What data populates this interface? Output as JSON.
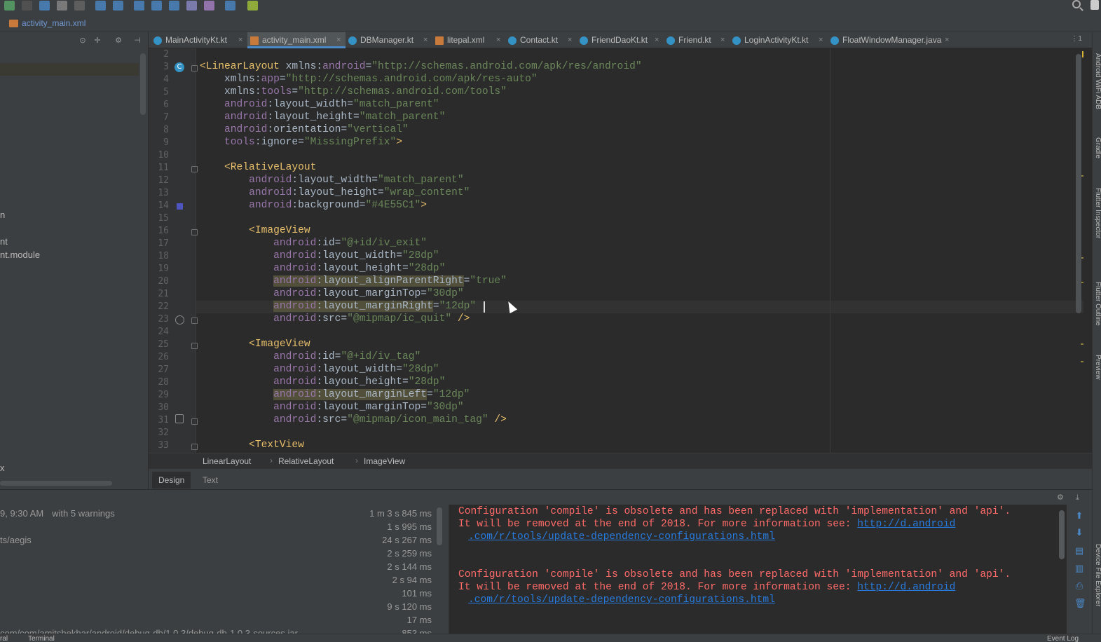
{
  "breadcrumb_file": "activity_main.xml",
  "project_panel": {
    "lines": [
      "n",
      "nt",
      "nt.module",
      "x"
    ]
  },
  "tabs": [
    {
      "label": "MainActivityKt.kt",
      "kind": "kotlin",
      "active": false
    },
    {
      "label": "activity_main.xml",
      "kind": "xml",
      "active": true
    },
    {
      "label": "DBManager.kt",
      "kind": "kotlin",
      "active": false
    },
    {
      "label": "litepal.xml",
      "kind": "xml",
      "active": false
    },
    {
      "label": "Contact.kt",
      "kind": "kotlin",
      "active": false
    },
    {
      "label": "FriendDaoKt.kt",
      "kind": "kotlin",
      "active": false
    },
    {
      "label": "Friend.kt",
      "kind": "kotlin",
      "active": false
    },
    {
      "label": "LoginActivityKt.kt",
      "kind": "kotlin",
      "active": false
    },
    {
      "label": "FloatWindowManager.java",
      "kind": "java",
      "active": false
    }
  ],
  "close_glyph": "×",
  "tabs_menu": "⋮1",
  "editor": {
    "line_numbers": [
      "2",
      "3",
      "4",
      "5",
      "6",
      "7",
      "8",
      "9",
      "10",
      "11",
      "12",
      "13",
      "14",
      "15",
      "16",
      "17",
      "18",
      "19",
      "20",
      "21",
      "22",
      "23",
      "24",
      "25",
      "26",
      "27",
      "28",
      "29",
      "30",
      "31",
      "32",
      "33"
    ],
    "code_lines": [
      "",
      "<LinearLayout xmlns:android=\"http://schemas.android.com/apk/res/android\"",
      "    xmlns:app=\"http://schemas.android.com/apk/res-auto\"",
      "    xmlns:tools=\"http://schemas.android.com/tools\"",
      "    android:layout_width=\"match_parent\"",
      "    android:layout_height=\"match_parent\"",
      "    android:orientation=\"vertical\"",
      "    tools:ignore=\"MissingPrefix\">",
      "",
      "    <RelativeLayout",
      "        android:layout_width=\"match_parent\"",
      "        android:layout_height=\"wrap_content\"",
      "        android:background=\"#4E55C1\">",
      "",
      "        <ImageView",
      "            android:id=\"@+id/iv_exit\"",
      "            android:layout_width=\"28dp\"",
      "            android:layout_height=\"28dp\"",
      "            android:layout_alignParentRight=\"true\"",
      "            android:layout_marginTop=\"30dp\"",
      "            android:layout_marginRight=\"12dp\"",
      "            android:src=\"@mipmap/ic_quit\" />",
      "",
      "        <ImageView",
      "            android:id=\"@+id/iv_tag\"",
      "            android:layout_width=\"28dp\"",
      "            android:layout_height=\"28dp\"",
      "            android:layout_marginLeft=\"12dp\"",
      "            android:layout_marginTop=\"30dp\"",
      "            android:src=\"@mipmap/icon_main_tag\" />",
      "",
      "        <TextView"
    ],
    "highlight_lines": [
      "20",
      "22",
      "29"
    ]
  },
  "breadcrumbs": [
    "LinearLayout",
    "RelativeLayout",
    "ImageView"
  ],
  "crumb_separator": "›",
  "design_tabs": [
    {
      "label": "Design",
      "active": true
    },
    {
      "label": "Text",
      "active": false
    }
  ],
  "build": {
    "rows": [
      {
        "name": "9, 9:30 AM",
        "warnings": "with 5 warnings",
        "time": "1 m 3 s 845 ms"
      },
      {
        "name": "",
        "warnings": "",
        "time": "1 s 995 ms"
      },
      {
        "name": "ts/aegis",
        "warnings": "",
        "time": "24 s 267 ms"
      },
      {
        "name": "",
        "warnings": "",
        "time": "2 s 259 ms"
      },
      {
        "name": "",
        "warnings": "",
        "time": "2 s 144 ms"
      },
      {
        "name": "",
        "warnings": "",
        "time": "2 s 94 ms"
      },
      {
        "name": "",
        "warnings": "",
        "time": "101 ms"
      },
      {
        "name": "",
        "warnings": "",
        "time": "9 s 120 ms"
      },
      {
        "name": "",
        "warnings": "",
        "time": "17 ms"
      },
      {
        "name": "com/com/amitshekhar/android/debug-db/1.0.3/debug-db-1.0.3-sources.jar",
        "warnings": "",
        "time": "853 ms"
      }
    ],
    "messages": [
      {
        "line1": "Configuration 'compile' is obsolete and has been replaced with 'implementation' and 'api'.",
        "line2_prefix": "It will be removed at the end of 2018. For more information see: ",
        "link1": "http://d.android",
        "link2": ".com/r/tools/update-dependency-configurations.html"
      },
      {
        "line1": "Configuration 'compile' is obsolete and has been replaced with 'implementation' and 'api'.",
        "line2_prefix": "It will be removed at the end of 2018. For more information see: ",
        "link1": "http://d.android",
        "link2": ".com/r/tools/update-dependency-configurations.html"
      }
    ]
  },
  "right_stripe": [
    "Android WiFi ADB",
    "Gradle",
    "Flutter Inspector",
    "Flutter Outline",
    "Preview",
    "Device File Explorer"
  ],
  "status": {
    "left": "ral",
    "terminal": "Terminal",
    "right": "Event Log"
  },
  "colors": {
    "accent": "#4a88c7",
    "error": "#ff6b68",
    "link": "#287bde",
    "tag": "#e8bf6a",
    "value": "#6a8759",
    "namespace": "#9876aa"
  }
}
